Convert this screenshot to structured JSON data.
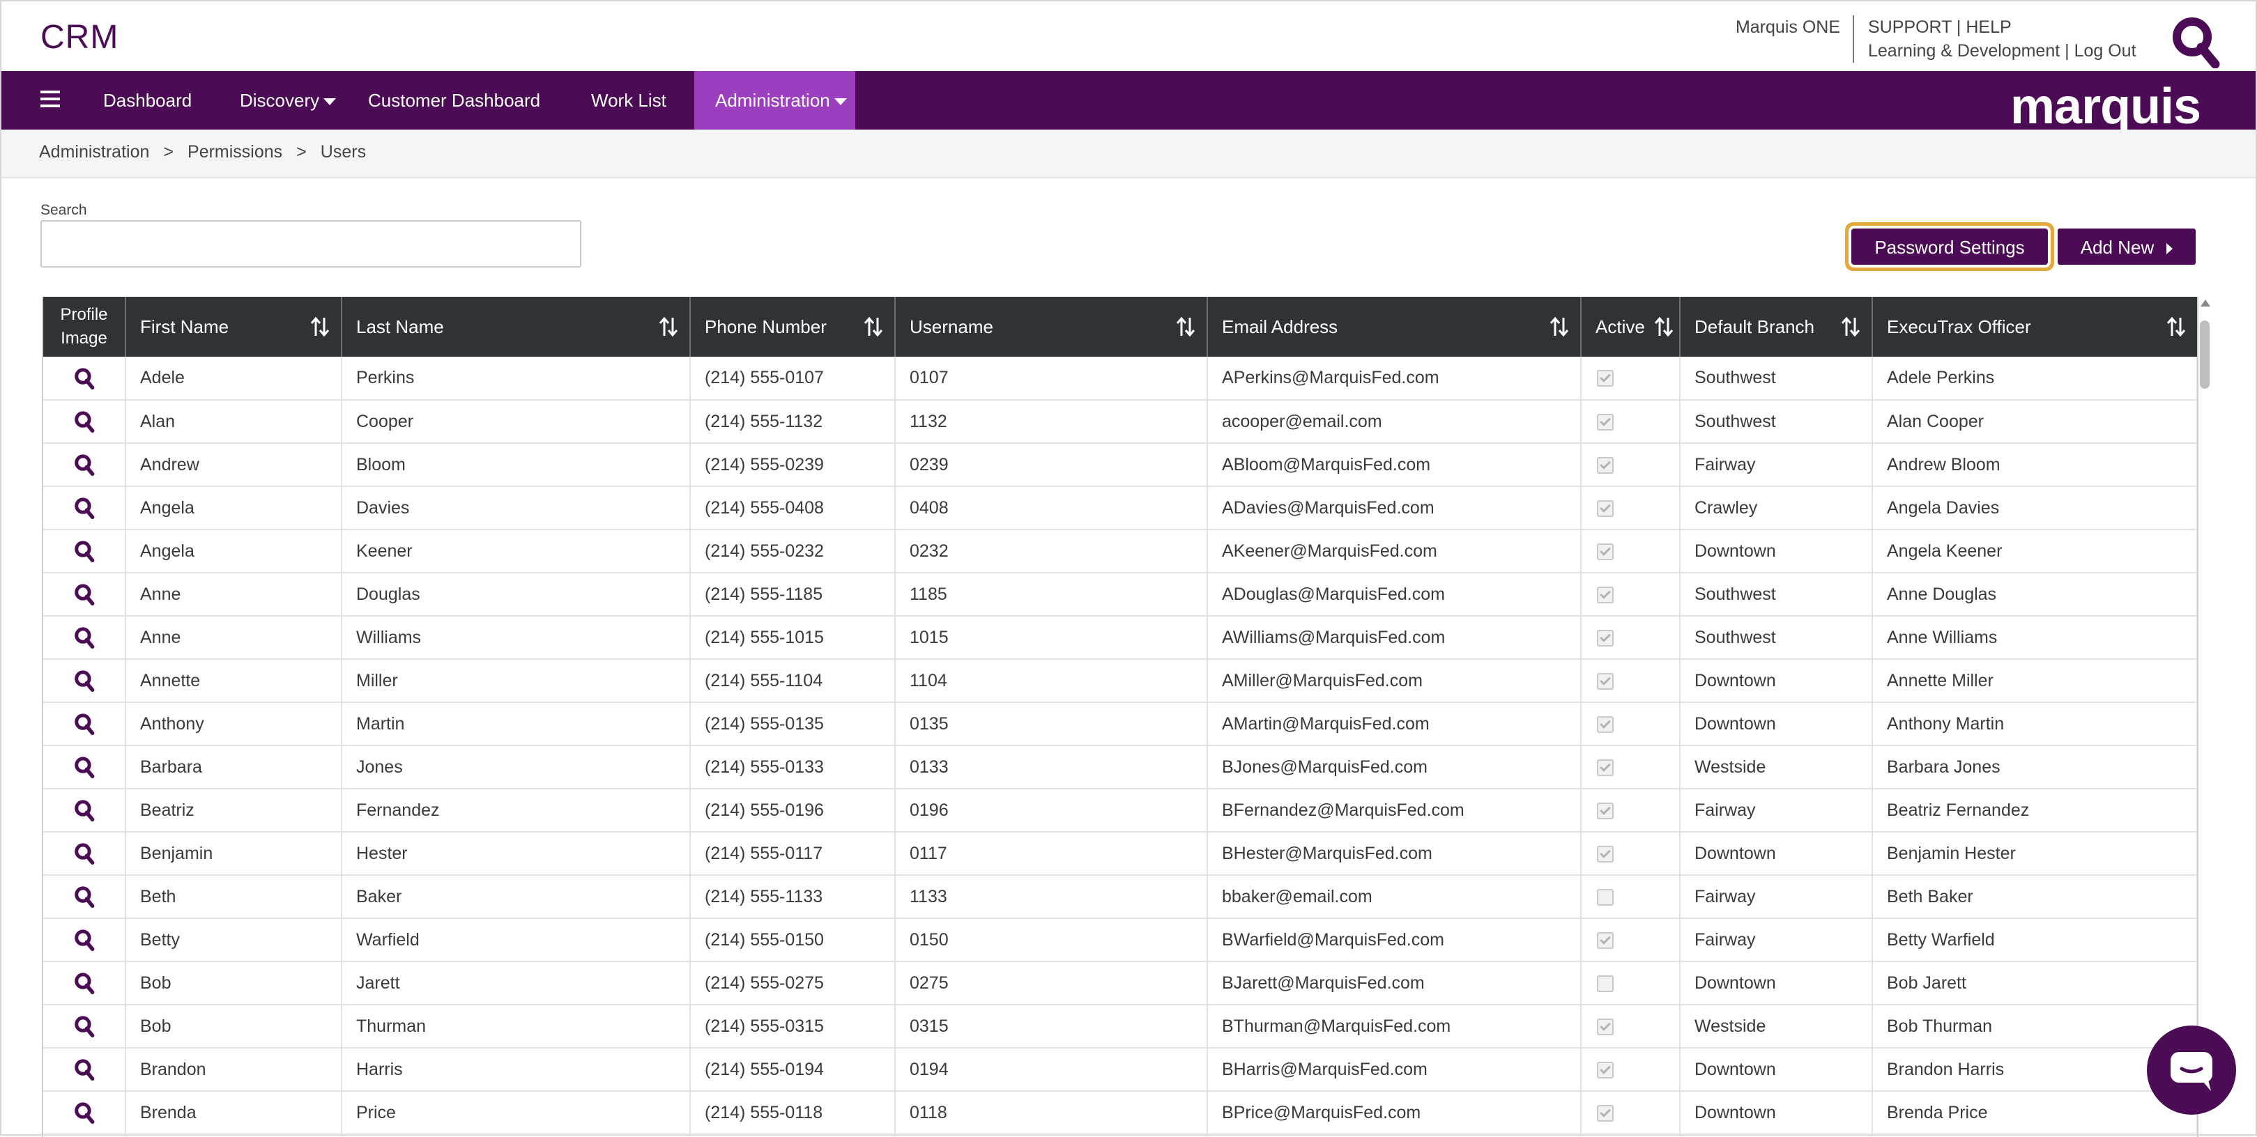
{
  "header": {
    "app_title": "CRM",
    "marquis_one": "Marquis ONE",
    "support": "SUPPORT",
    "help": "HELP",
    "link_sep": " | ",
    "learning": "Learning & Development",
    "logout": "Log Out",
    "logo_icon": "marquis-q-icon"
  },
  "nav": {
    "menu_icon": "hamburger-icon",
    "items": [
      {
        "label": "Dashboard"
      },
      {
        "label": "Discovery"
      },
      {
        "label": "Customer Dashboard"
      },
      {
        "label": "Work List"
      },
      {
        "label": "Administration"
      }
    ],
    "brand": "marquis",
    "colors": {
      "bar": "#4b0b55",
      "active": "#9b3fbf"
    }
  },
  "breadcrumb": {
    "items": [
      "Administration",
      "Permissions",
      "Users"
    ],
    "separator": ">"
  },
  "search": {
    "label": "Search",
    "value": "",
    "placeholder": ""
  },
  "actions": {
    "password_settings": "Password Settings",
    "add_new": "Add New",
    "highlight_color": "#e5a83c"
  },
  "table": {
    "columns": [
      "Profile Image",
      "First Name",
      "Last Name",
      "Phone Number",
      "Username",
      "Email Address",
      "Active",
      "Default Branch",
      "ExecuTrax Officer"
    ],
    "profile_header_lines": [
      "Profile",
      "Image"
    ],
    "rows": [
      {
        "first": "Adele",
        "last": "Perkins",
        "phone": "(214) 555-0107",
        "username": "0107",
        "email": "APerkins@MarquisFed.com",
        "active": true,
        "branch": "Southwest",
        "officer": "Adele Perkins"
      },
      {
        "first": "Alan",
        "last": "Cooper",
        "phone": "(214) 555-1132",
        "username": "1132",
        "email": "acooper@email.com",
        "active": true,
        "branch": "Southwest",
        "officer": "Alan Cooper"
      },
      {
        "first": "Andrew",
        "last": "Bloom",
        "phone": "(214) 555-0239",
        "username": "0239",
        "email": "ABloom@MarquisFed.com",
        "active": true,
        "branch": "Fairway",
        "officer": "Andrew Bloom"
      },
      {
        "first": "Angela",
        "last": "Davies",
        "phone": "(214) 555-0408",
        "username": "0408",
        "email": "ADavies@MarquisFed.com",
        "active": true,
        "branch": "Crawley",
        "officer": "Angela Davies"
      },
      {
        "first": "Angela",
        "last": "Keener",
        "phone": "(214) 555-0232",
        "username": "0232",
        "email": "AKeener@MarquisFed.com",
        "active": true,
        "branch": "Downtown",
        "officer": "Angela Keener"
      },
      {
        "first": "Anne",
        "last": "Douglas",
        "phone": "(214) 555-1185",
        "username": "1185",
        "email": "ADouglas@MarquisFed.com",
        "active": true,
        "branch": "Southwest",
        "officer": "Anne Douglas"
      },
      {
        "first": "Anne",
        "last": "Williams",
        "phone": "(214) 555-1015",
        "username": "1015",
        "email": "AWilliams@MarquisFed.com",
        "active": true,
        "branch": "Southwest",
        "officer": "Anne Williams"
      },
      {
        "first": "Annette",
        "last": "Miller",
        "phone": "(214) 555-1104",
        "username": "1104",
        "email": "AMiller@MarquisFed.com",
        "active": true,
        "branch": "Downtown",
        "officer": "Annette Miller"
      },
      {
        "first": "Anthony",
        "last": "Martin",
        "phone": "(214) 555-0135",
        "username": "0135",
        "email": "AMartin@MarquisFed.com",
        "active": true,
        "branch": "Downtown",
        "officer": "Anthony Martin"
      },
      {
        "first": "Barbara",
        "last": "Jones",
        "phone": "(214) 555-0133",
        "username": "0133",
        "email": "BJones@MarquisFed.com",
        "active": true,
        "branch": "Westside",
        "officer": "Barbara Jones"
      },
      {
        "first": "Beatriz",
        "last": "Fernandez",
        "phone": "(214) 555-0196",
        "username": "0196",
        "email": "BFernandez@MarquisFed.com",
        "active": true,
        "branch": "Fairway",
        "officer": "Beatriz Fernandez"
      },
      {
        "first": "Benjamin",
        "last": "Hester",
        "phone": "(214) 555-0117",
        "username": "0117",
        "email": "BHester@MarquisFed.com",
        "active": true,
        "branch": "Downtown",
        "officer": "Benjamin Hester"
      },
      {
        "first": "Beth",
        "last": "Baker",
        "phone": "(214) 555-1133",
        "username": "1133",
        "email": "bbaker@email.com",
        "active": false,
        "branch": "Fairway",
        "officer": "Beth Baker"
      },
      {
        "first": "Betty",
        "last": "Warfield",
        "phone": "(214) 555-0150",
        "username": "0150",
        "email": "BWarfield@MarquisFed.com",
        "active": true,
        "branch": "Fairway",
        "officer": "Betty Warfield"
      },
      {
        "first": "Bob",
        "last": "Jarett",
        "phone": "(214) 555-0275",
        "username": "0275",
        "email": "BJarett@MarquisFed.com",
        "active": false,
        "branch": "Downtown",
        "officer": "Bob Jarett"
      },
      {
        "first": "Bob",
        "last": "Thurman",
        "phone": "(214) 555-0315",
        "username": "0315",
        "email": "BThurman@MarquisFed.com",
        "active": true,
        "branch": "Westside",
        "officer": "Bob Thurman"
      },
      {
        "first": "Brandon",
        "last": "Harris",
        "phone": "(214) 555-0194",
        "username": "0194",
        "email": "BHarris@MarquisFed.com",
        "active": true,
        "branch": "Downtown",
        "officer": "Brandon Harris"
      },
      {
        "first": "Brenda",
        "last": "Price",
        "phone": "(214) 555-0118",
        "username": "0118",
        "email": "BPrice@MarquisFed.com",
        "active": true,
        "branch": "Downtown",
        "officer": "Brenda Price"
      }
    ]
  },
  "chat": {
    "icon": "chat-bubble-icon"
  }
}
